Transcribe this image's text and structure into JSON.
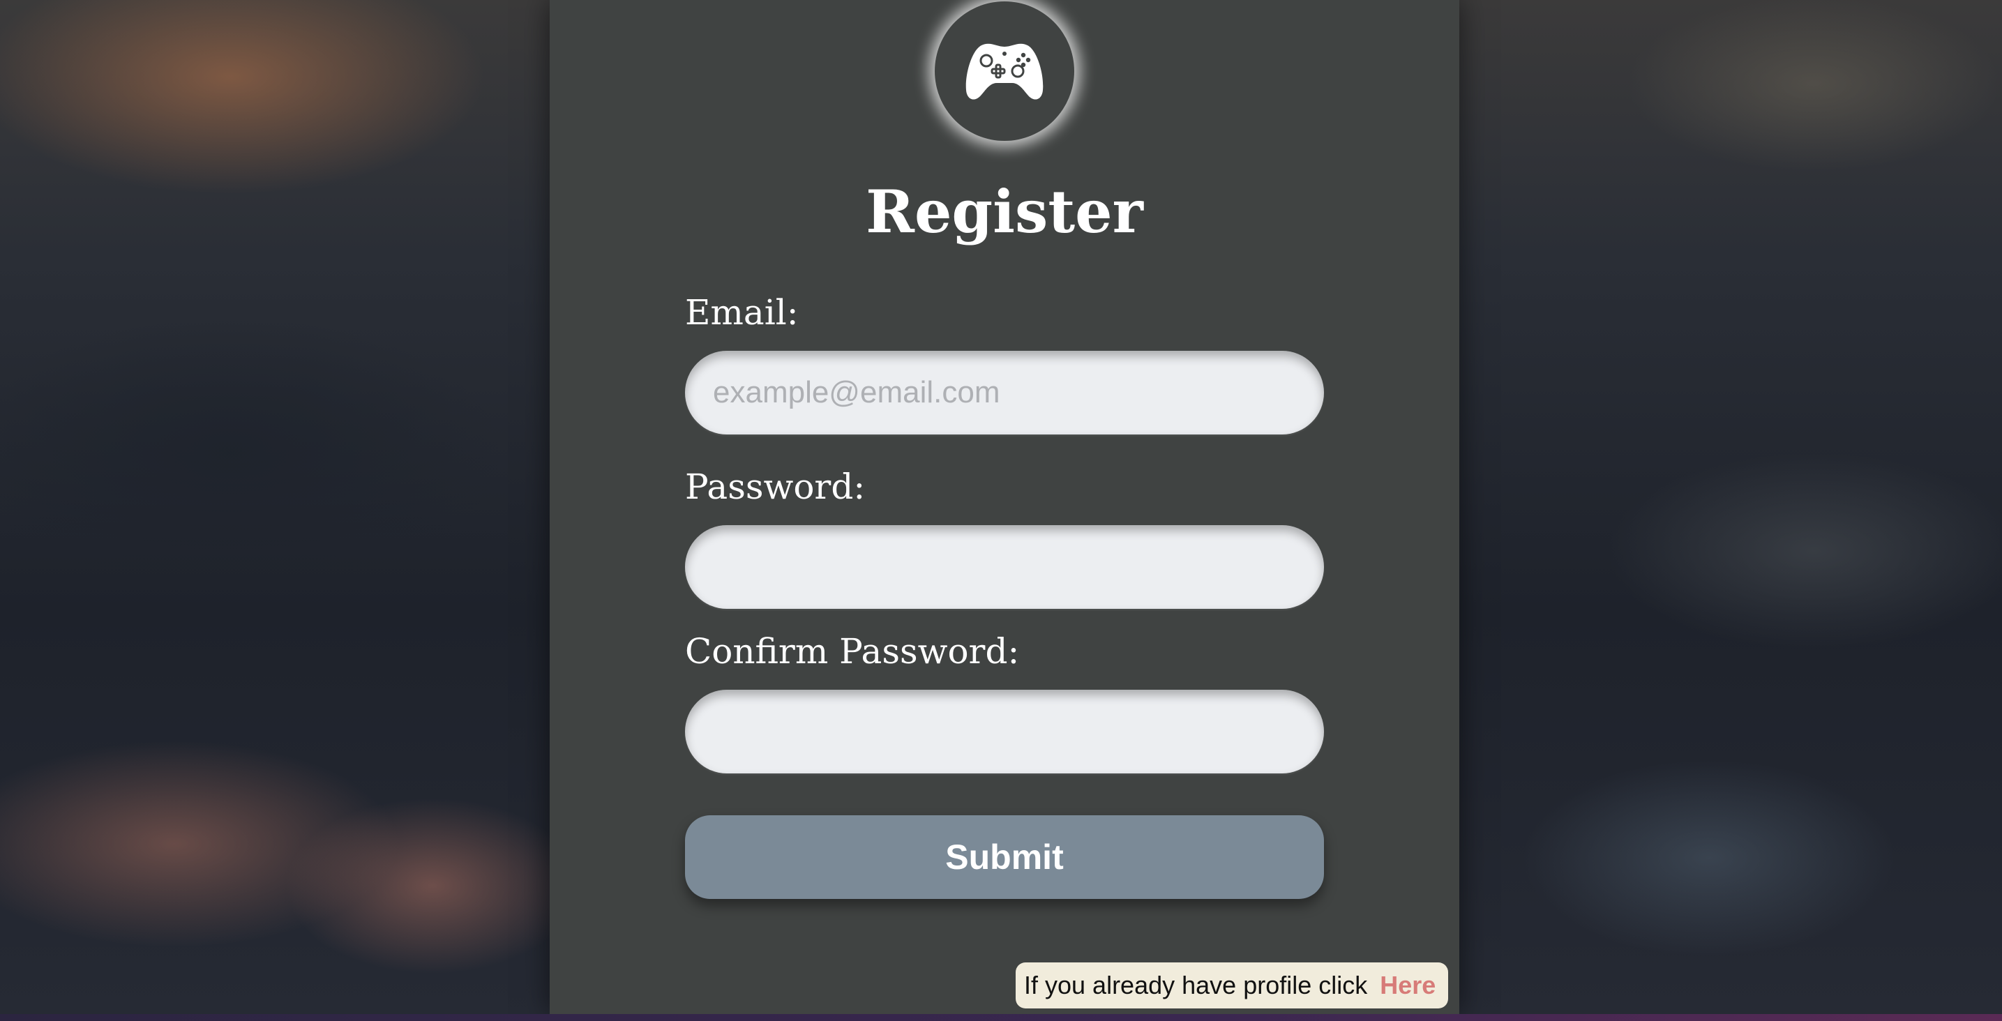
{
  "page": {
    "title": "Register",
    "logo_icon": "gamepad-icon"
  },
  "form": {
    "email": {
      "label": "Email:",
      "placeholder": "example@email.com",
      "value": ""
    },
    "password": {
      "label": "Password:",
      "placeholder": "",
      "value": ""
    },
    "confirm_password": {
      "label": "Confirm Password:",
      "placeholder": "",
      "value": ""
    },
    "submit_label": "Submit"
  },
  "footer": {
    "login_prompt": "If you already have profile click",
    "login_link": "Here"
  },
  "colors": {
    "panel": "#404342",
    "submit_button": "#7b8a97",
    "link": "#d77b78",
    "note_background": "#f1ecdc"
  }
}
